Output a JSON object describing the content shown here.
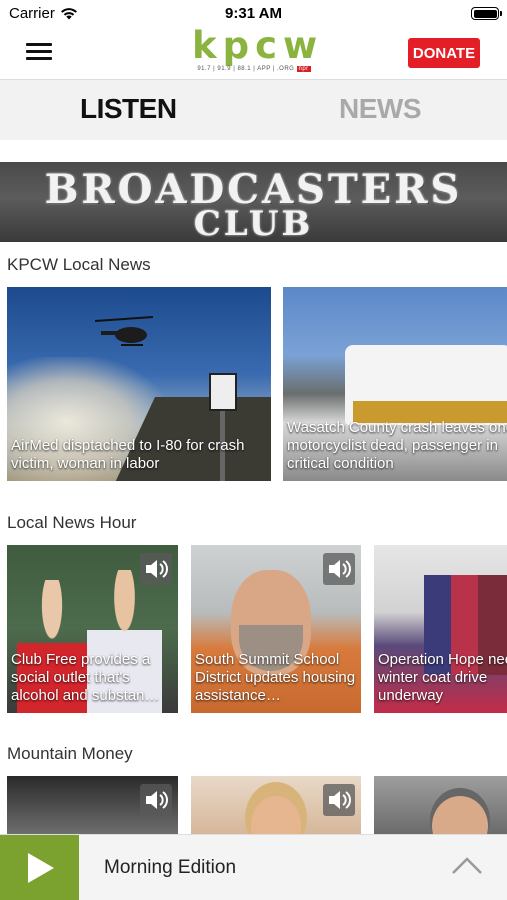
{
  "status_bar": {
    "carrier": "Carrier",
    "time": "9:31 AM"
  },
  "header": {
    "logo_text": "kpcw",
    "logo_sub": "91.7 | 91.9 | 88.1 | APP | .ORG",
    "logo_npr": "npr",
    "donate_label": "DONATE"
  },
  "tabs": [
    {
      "label": "LISTEN",
      "active": true
    },
    {
      "label": "NEWS",
      "active": false
    }
  ],
  "banner": {
    "line1": "BROADCASTERS",
    "line2": "CLUB"
  },
  "sections": [
    {
      "title": "KPCW Local News",
      "items": [
        {
          "caption": "AirMed disptached to I-80 for crash victim, woman in labor"
        },
        {
          "caption": "Wasatch County crash leaves one motorcyclist dead, passenger in critical condition"
        }
      ]
    },
    {
      "title": "Local News Hour",
      "items": [
        {
          "caption": "Club Free provides a social outlet that's alcohol and substan…",
          "icon": "speaker-icon"
        },
        {
          "caption": "South Summit School District updates housing assistance…",
          "icon": "speaker-icon"
        },
        {
          "caption": "Operation Hope needs winter coat drive underway",
          "icon": "speaker-icon"
        }
      ]
    },
    {
      "title": "Mountain Money",
      "items": [
        {
          "caption": "",
          "icon": "speaker-icon"
        },
        {
          "caption": "",
          "icon": "speaker-icon"
        },
        {
          "caption": ""
        }
      ]
    }
  ],
  "player": {
    "title": "Morning Edition",
    "icon": "play-icon",
    "expand_icon": "chevron-up-icon"
  },
  "colors": {
    "brand_green": "#7ba12f",
    "logo_green": "#8bb33f",
    "donate_red": "#e41e26",
    "inactive_tab": "#a9a9a9"
  }
}
